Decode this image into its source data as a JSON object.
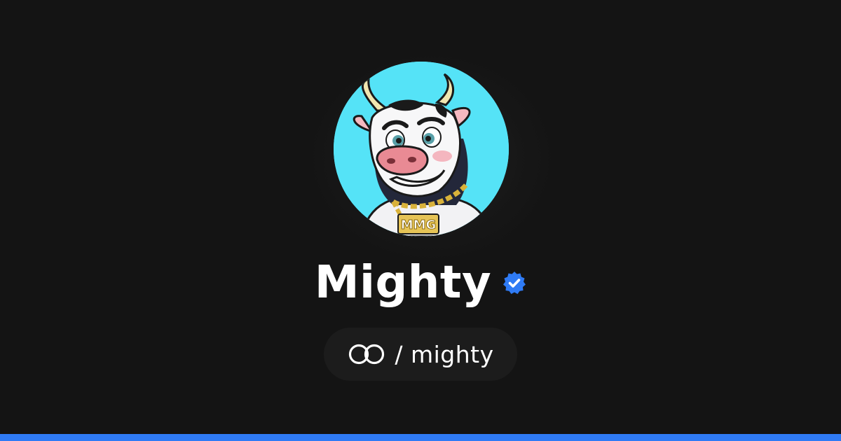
{
  "profile": {
    "display_name": "Mighty",
    "verified": true,
    "handle_separator": "/",
    "handle": "mighty",
    "handle_text": "/ mighty",
    "avatar_icon": "cow-avatar",
    "badge_icon": "verified-badge-icon",
    "brand_icon": "linked-rings-icon"
  },
  "colors": {
    "background": "#141414",
    "pill_background": "#1c1c1c",
    "avatar_background": "#55e3f7",
    "accent": "#2f7bf5",
    "text": "#ffffff"
  }
}
